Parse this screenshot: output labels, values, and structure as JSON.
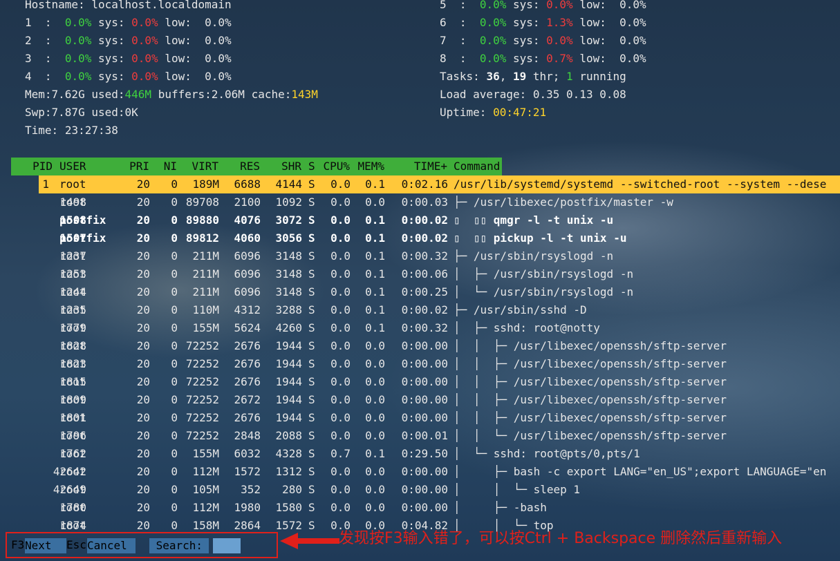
{
  "meters": {
    "hostname_label": "Hostname:",
    "hostname": "localhost.localdomain",
    "cpus_left": [
      {
        "id": "1",
        "norm": "0.0%",
        "sys": "0.0%",
        "low": "0.0%"
      },
      {
        "id": "2",
        "norm": "0.0%",
        "sys": "0.0%",
        "low": "0.0%"
      },
      {
        "id": "3",
        "norm": "0.0%",
        "sys": "0.0%",
        "low": "0.0%"
      },
      {
        "id": "4",
        "norm": "0.0%",
        "sys": "0.0%",
        "low": "0.0%"
      }
    ],
    "cpus_right": [
      {
        "id": "5",
        "norm": "0.0%",
        "sys": "0.0%",
        "low": "0.0%"
      },
      {
        "id": "6",
        "norm": "0.0%",
        "sys": "1.3%",
        "low": "0.0%"
      },
      {
        "id": "7",
        "norm": "0.0%",
        "sys": "0.0%",
        "low": "0.0%"
      },
      {
        "id": "8",
        "norm": "0.0%",
        "sys": "0.7%",
        "low": "0.0%"
      }
    ],
    "sys_label": "sys:",
    "low_label": "low:",
    "mem_label": "Mem:",
    "mem_total": "7.62G",
    "used_label": "used:",
    "mem_used": "446M",
    "buffers_label": "buffers:",
    "mem_buffers": "2.06M",
    "cache_label": "cache:",
    "mem_cache": "143M",
    "swp_label": "Swp:",
    "swp_total": "7.87G",
    "swp_used": "0K",
    "time_label": "Time:",
    "time": "23:27:38",
    "tasks_label": "Tasks:",
    "tasks": "36",
    "thr": "19",
    "thr_label": "thr;",
    "running": "1",
    "running_label": "running",
    "load_label": "Load average:",
    "load": "0.35 0.13 0.08",
    "uptime_label": "Uptime:",
    "uptime": "00:47:21"
  },
  "columns": {
    "pid": "PID",
    "user": "USER",
    "pri": "PRI",
    "ni": "NI",
    "virt": "VIRT",
    "res": "RES",
    "shr": "SHR",
    "s": "S",
    "cpu": "CPU%",
    "mem": "MEM%",
    "time": "TIME+",
    "cmd": "Command"
  },
  "selected": {
    "pid": "1",
    "user": "root",
    "pri": "20",
    "ni": "0",
    "virt": "189M",
    "res": "6688",
    "shr": "4144",
    "s": "S",
    "cpu": "0.0",
    "mem": "0.1",
    "time": "0:02.16",
    "cmd": "/usr/lib/systemd/systemd --switched-root --system --dese"
  },
  "processes": [
    {
      "pid": "1498",
      "user": "root",
      "pri": "20",
      "ni": "0",
      "virt": "89708",
      "res": "2100",
      "shr": "1092",
      "s": "S",
      "cpu": "0.0",
      "mem": "0.0",
      "time": "0:00.03",
      "cmd": "├─ /usr/libexec/postfix/master -w",
      "bold": false
    },
    {
      "pid": "1508",
      "user": "postfix",
      "pri": "20",
      "ni": "0",
      "virt": "89880",
      "res": "4076",
      "shr": "3072",
      "s": "S",
      "cpu": "0.0",
      "mem": "0.1",
      "time": "0:00.02",
      "cmd": "▯  ▯▯ qmgr -l -t unix -u",
      "bold": true
    },
    {
      "pid": "1507",
      "user": "postfix",
      "pri": "20",
      "ni": "0",
      "virt": "89812",
      "res": "4060",
      "shr": "3056",
      "s": "S",
      "cpu": "0.0",
      "mem": "0.1",
      "time": "0:00.02",
      "cmd": "▯  ▯▯ pickup -l -t unix -u",
      "bold": true
    },
    {
      "pid": "1237",
      "user": "root",
      "pri": "20",
      "ni": "0",
      "virt": "211M",
      "res": "6096",
      "shr": "3148",
      "s": "S",
      "cpu": "0.0",
      "mem": "0.1",
      "time": "0:00.32",
      "cmd": "├─ /usr/sbin/rsyslogd -n",
      "bold": false
    },
    {
      "pid": "1253",
      "user": "root",
      "pri": "20",
      "ni": "0",
      "virt": "211M",
      "res": "6096",
      "shr": "3148",
      "s": "S",
      "cpu": "0.0",
      "mem": "0.1",
      "time": "0:00.06",
      "cmd": "│  ├─ /usr/sbin/rsyslogd -n",
      "bold": false
    },
    {
      "pid": "1244",
      "user": "root",
      "pri": "20",
      "ni": "0",
      "virt": "211M",
      "res": "6096",
      "shr": "3148",
      "s": "S",
      "cpu": "0.0",
      "mem": "0.1",
      "time": "0:00.25",
      "cmd": "│  └─ /usr/sbin/rsyslogd -n",
      "bold": false
    },
    {
      "pid": "1235",
      "user": "root",
      "pri": "20",
      "ni": "0",
      "virt": "110M",
      "res": "4312",
      "shr": "3288",
      "s": "S",
      "cpu": "0.0",
      "mem": "0.1",
      "time": "0:00.02",
      "cmd": "├─ /usr/sbin/sshd -D",
      "bold": false
    },
    {
      "pid": "1779",
      "user": "root",
      "pri": "20",
      "ni": "0",
      "virt": "155M",
      "res": "5624",
      "shr": "4260",
      "s": "S",
      "cpu": "0.0",
      "mem": "0.1",
      "time": "0:00.32",
      "cmd": "│  ├─ sshd: root@notty",
      "bold": false
    },
    {
      "pid": "1828",
      "user": "root",
      "pri": "20",
      "ni": "0",
      "virt": "72252",
      "res": "2676",
      "shr": "1944",
      "s": "S",
      "cpu": "0.0",
      "mem": "0.0",
      "time": "0:00.00",
      "cmd": "│  │  ├─ /usr/libexec/openssh/sftp-server",
      "bold": false
    },
    {
      "pid": "1823",
      "user": "root",
      "pri": "20",
      "ni": "0",
      "virt": "72252",
      "res": "2676",
      "shr": "1944",
      "s": "S",
      "cpu": "0.0",
      "mem": "0.0",
      "time": "0:00.00",
      "cmd": "│  │  ├─ /usr/libexec/openssh/sftp-server",
      "bold": false
    },
    {
      "pid": "1815",
      "user": "root",
      "pri": "20",
      "ni": "0",
      "virt": "72252",
      "res": "2676",
      "shr": "1944",
      "s": "S",
      "cpu": "0.0",
      "mem": "0.0",
      "time": "0:00.00",
      "cmd": "│  │  ├─ /usr/libexec/openssh/sftp-server",
      "bold": false
    },
    {
      "pid": "1809",
      "user": "root",
      "pri": "20",
      "ni": "0",
      "virt": "72252",
      "res": "2672",
      "shr": "1944",
      "s": "S",
      "cpu": "0.0",
      "mem": "0.0",
      "time": "0:00.00",
      "cmd": "│  │  ├─ /usr/libexec/openssh/sftp-server",
      "bold": false
    },
    {
      "pid": "1801",
      "user": "root",
      "pri": "20",
      "ni": "0",
      "virt": "72252",
      "res": "2676",
      "shr": "1944",
      "s": "S",
      "cpu": "0.0",
      "mem": "0.0",
      "time": "0:00.00",
      "cmd": "│  │  ├─ /usr/libexec/openssh/sftp-server",
      "bold": false
    },
    {
      "pid": "1796",
      "user": "root",
      "pri": "20",
      "ni": "0",
      "virt": "72252",
      "res": "2848",
      "shr": "2088",
      "s": "S",
      "cpu": "0.0",
      "mem": "0.0",
      "time": "0:00.01",
      "cmd": "│  │  └─ /usr/libexec/openssh/sftp-server",
      "bold": false
    },
    {
      "pid": "1762",
      "user": "root",
      "pri": "20",
      "ni": "0",
      "virt": "155M",
      "res": "6032",
      "shr": "4328",
      "s": "S",
      "cpu": "0.7",
      "mem": "0.1",
      "time": "0:29.50",
      "cmd": "│  └─ sshd: root@pts/0,pts/1",
      "bold": false
    },
    {
      "pid": "42642",
      "user": "root",
      "pri": "20",
      "ni": "0",
      "virt": "112M",
      "res": "1572",
      "shr": "1312",
      "s": "S",
      "cpu": "0.0",
      "mem": "0.0",
      "time": "0:00.00",
      "cmd": "│     ├─ bash -c export LANG=\"en_US\";export LANGUAGE=\"en",
      "bold": false
    },
    {
      "pid": "42649",
      "user": "root",
      "pri": "20",
      "ni": "0",
      "virt": "105M",
      "res": "352",
      "shr": "280",
      "s": "S",
      "cpu": "0.0",
      "mem": "0.0",
      "time": "0:00.00",
      "cmd": "│     │  └─ sleep 1",
      "bold": false
    },
    {
      "pid": "1780",
      "user": "root",
      "pri": "20",
      "ni": "0",
      "virt": "112M",
      "res": "1980",
      "shr": "1580",
      "s": "S",
      "cpu": "0.0",
      "mem": "0.0",
      "time": "0:00.00",
      "cmd": "│     ├─ -bash",
      "bold": false
    },
    {
      "pid": "1874",
      "user": "root",
      "pri": "20",
      "ni": "0",
      "virt": "158M",
      "res": "2864",
      "shr": "1572",
      "s": "S",
      "cpu": "0.0",
      "mem": "0.0",
      "time": "0:04.82",
      "cmd": "│     │  └─ top",
      "bold": false
    }
  ],
  "footer": {
    "f3_key": "F3",
    "f3_label": "Next",
    "esc_key": "Esc",
    "esc_label": "Cancel",
    "search_label": " Search:",
    "search_value": ""
  },
  "annotation": {
    "text": "发现按F3输入错了，可以按Ctrl + Backspace 删除然后重新输入",
    "color": "#e0201a"
  }
}
